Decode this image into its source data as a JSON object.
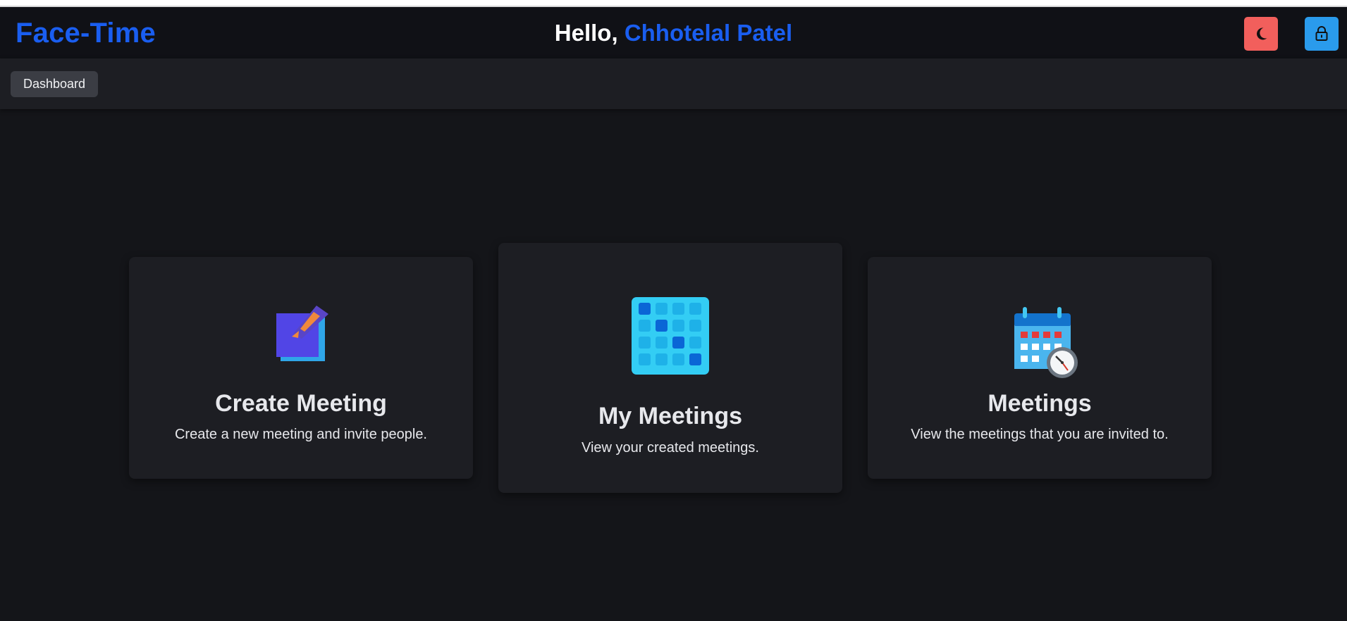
{
  "header": {
    "brand": "Face-Time",
    "greeting_prefix": "Hello,",
    "user_name": "Chhotelal Patel"
  },
  "nav": {
    "dashboard_label": "Dashboard"
  },
  "cards": [
    {
      "title": "Create Meeting",
      "description": "Create a new meeting and invite people.",
      "icon": "create-meeting-icon"
    },
    {
      "title": "My Meetings",
      "description": "View your created meetings.",
      "icon": "calendar-grid-icon"
    },
    {
      "title": "Meetings",
      "description": "View the meetings that you are invited to.",
      "icon": "calendar-clock-icon"
    }
  ],
  "colors": {
    "background": "#141519",
    "header": "#101116",
    "card": "#1d1e23",
    "accent_blue": "#1a5ef0",
    "theme_button": "#f25f5c",
    "lock_button": "#2a9bec"
  },
  "icons": {
    "theme_toggle": "moon-icon",
    "logout": "lock-icon"
  }
}
